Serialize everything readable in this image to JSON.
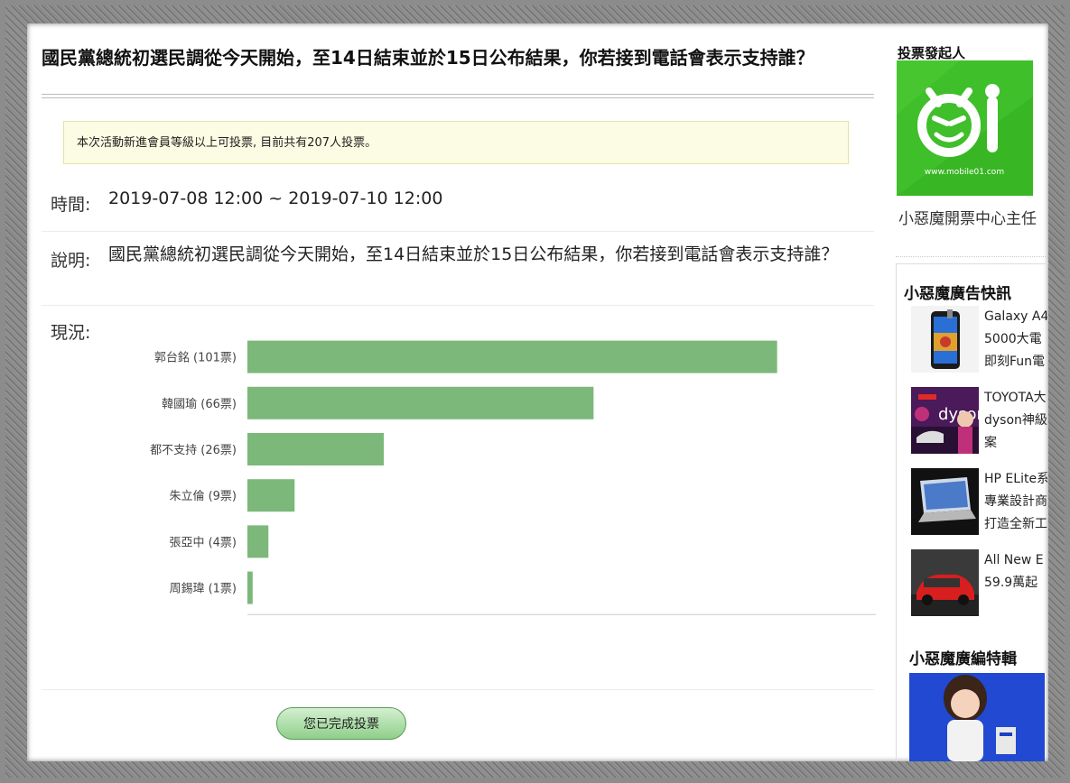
{
  "poll": {
    "title": "國民黨總統初選民調從今天開始，至14日結束並於15日公布結果，你若接到電話會表示支持誰？",
    "notice": "本次活動新進會員等級以上可投票, 目前共有207人投票。",
    "time_label": "時間:",
    "time_value": "2019-07-08 12:00 ~ 2019-07-10 12:00",
    "desc_label": "說明:",
    "desc_value": "國民黨總統初選民調從今天開始，至14日結束並於15日公布結果，你若接到電話會表示支持誰？",
    "status_label": "現況:",
    "done_button": "您已完成投票"
  },
  "chart_data": {
    "type": "bar",
    "orientation": "horizontal",
    "categories": [
      "郭台銘 (101票)",
      "韓國瑜 (66票)",
      "都不支持 (26票)",
      "朱立倫 (9票)",
      "張亞中 (4票)",
      "周錫瑋 (1票)"
    ],
    "values": [
      101,
      66,
      26,
      9,
      4,
      1
    ],
    "xlim": [
      0,
      120
    ],
    "xticks": [
      0,
      20,
      40,
      60,
      80,
      100,
      120
    ],
    "bar_color": "#7cb87a",
    "grid": false
  },
  "sidebar": {
    "initiator_heading": "投票發起人",
    "logo_text": "www.mobile01.com",
    "owner_name": "小惡魔開票中心主任",
    "ads_heading": "小惡魔廣告快訊",
    "ads": [
      {
        "lines": [
          "Galaxy A4",
          "5000大電",
          "即刻Fun電"
        ],
        "thumb": "phone-ad-image"
      },
      {
        "lines": [
          "TOYOTA大",
          "dyson神級",
          "案"
        ],
        "thumb": "dyson-ad-image",
        "badge": "dyson"
      },
      {
        "lines": [
          "HP ELite系",
          "專業設計商",
          "打造全新工"
        ],
        "thumb": "laptop-ad-image"
      },
      {
        "lines": [
          "All New E",
          "59.9萬起"
        ],
        "thumb": "car-ad-image"
      }
    ],
    "special_heading": "小惡魔廣編特輯"
  },
  "colors": {
    "bar": "#7cb87a",
    "logo_green": "#3fbf2a",
    "notice_bg": "#fcfbe3",
    "button_green": "#8fcf8a"
  }
}
